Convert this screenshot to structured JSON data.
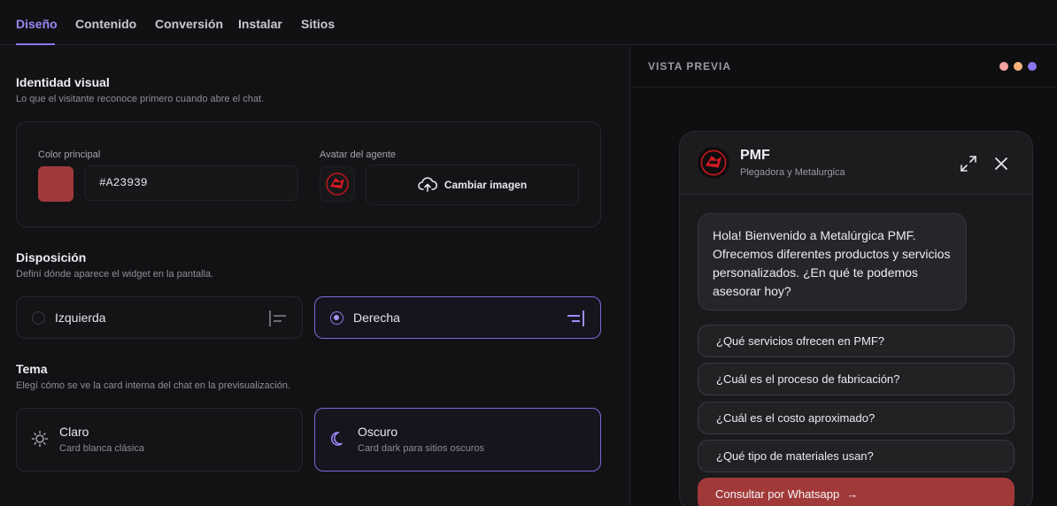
{
  "tabs": [
    {
      "label": "Diseño",
      "active": true
    },
    {
      "label": "Contenido",
      "active": false
    },
    {
      "label": "Conversión",
      "active": false
    },
    {
      "label": "Instalar",
      "active": false
    },
    {
      "label": "Sitios",
      "active": false
    }
  ],
  "identity": {
    "title": "Identidad visual",
    "subtitle": "Lo que el visitante reconoce primero cuando abre el chat.",
    "color_label": "Color principal",
    "color_value": "#A23939",
    "avatar_label": "Avatar del agente",
    "change_image_label": "Cambiar imagen"
  },
  "layout": {
    "title": "Disposición",
    "subtitle": "Definí dónde aparece el widget en la pantalla.",
    "options": [
      {
        "label": "Izquierda",
        "selected": false,
        "icon": "align-left-icon"
      },
      {
        "label": "Derecha",
        "selected": true,
        "icon": "align-right-icon"
      }
    ]
  },
  "theme": {
    "title": "Tema",
    "subtitle": "Elegí cómo se ve la card interna del chat en la previsualización.",
    "options": [
      {
        "title": "Claro",
        "subtitle": "Card blanca clásica",
        "selected": false,
        "icon": "sun-icon"
      },
      {
        "title": "Oscuro",
        "subtitle": "Card dark para sitios oscuros",
        "selected": true,
        "icon": "moon-icon"
      }
    ]
  },
  "preview": {
    "title": "VISTA PREVIA",
    "dots": [
      "#f4a3a3",
      "#f5b27a",
      "#8b74f0"
    ],
    "chat": {
      "name": "PMF",
      "subtitle": "Plegadora y Metalurgica",
      "greeting": "Hola! Bienvenido a Metalúrgica PMF. Ofrecemos diferentes productos y servicios personalizados. ¿En qué te podemos asesorar hoy?",
      "quick_replies": [
        "¿Qué servicios ofrecen en PMF?",
        "¿Cuál es el proceso de fabricación?",
        "¿Cuál es el costo aproximado?",
        "¿Qué tipo de materiales usan?"
      ],
      "whatsapp_label": "Consultar por Whatsapp",
      "whatsapp_arrow": "→"
    }
  },
  "colors": {
    "accent": "#8b74f0",
    "brand": "#A23939"
  }
}
